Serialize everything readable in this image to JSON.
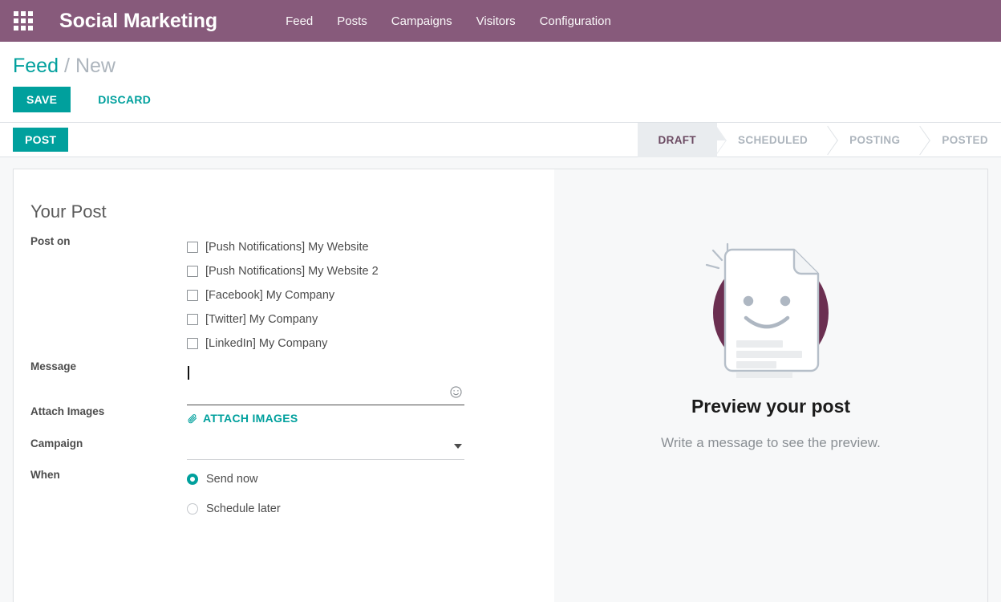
{
  "navbar": {
    "apps_icon": "apps-grid-icon",
    "brand": "Social Marketing",
    "menu": [
      {
        "label": "Feed"
      },
      {
        "label": "Posts"
      },
      {
        "label": "Campaigns"
      },
      {
        "label": "Visitors"
      },
      {
        "label": "Configuration"
      }
    ]
  },
  "breadcrumb": {
    "root": "Feed",
    "separator": "/",
    "current": "New"
  },
  "actions": {
    "save_label": "SAVE",
    "discard_label": "DISCARD"
  },
  "statusbar": {
    "post_button": "POST",
    "stages": [
      {
        "label": "DRAFT",
        "active": true
      },
      {
        "label": "SCHEDULED",
        "active": false
      },
      {
        "label": "POSTING",
        "active": false
      },
      {
        "label": "POSTED",
        "active": false
      }
    ]
  },
  "form": {
    "title": "Your Post",
    "post_on": {
      "label": "Post on",
      "options": [
        {
          "label": "[Push Notifications] My Website",
          "checked": false
        },
        {
          "label": "[Push Notifications] My Website 2",
          "checked": false
        },
        {
          "label": "[Facebook] My Company",
          "checked": false
        },
        {
          "label": "[Twitter] My Company",
          "checked": false
        },
        {
          "label": "[LinkedIn] My Company",
          "checked": false
        }
      ]
    },
    "message": {
      "label": "Message",
      "value": "",
      "placeholder": "",
      "emoji_icon": "smiley-face-icon"
    },
    "attach_images": {
      "label": "Attach Images",
      "button_label": "ATTACH IMAGES",
      "icon": "paperclip-icon"
    },
    "campaign": {
      "label": "Campaign",
      "value": "",
      "caret_icon": "chevron-down-icon"
    },
    "when": {
      "label": "When",
      "options": [
        {
          "label": "Send now",
          "selected": true
        },
        {
          "label": "Schedule later",
          "selected": false
        }
      ]
    }
  },
  "preview": {
    "illustration": "smiling-document-illustration",
    "title": "Preview your post",
    "subtitle": "Write a message to see the preview."
  },
  "colors": {
    "brand_purple": "#875A7B",
    "accent_teal": "#00A09D",
    "panel_gray": "#F7F8F9",
    "stage_active_bg": "#E9ECEF",
    "illustration_circle": "#6B2F51"
  }
}
